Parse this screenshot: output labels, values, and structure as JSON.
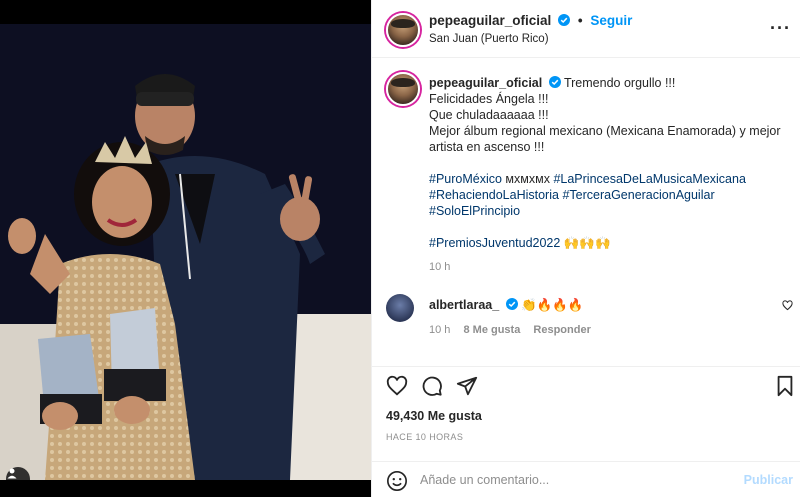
{
  "post": {
    "username": "pepeaguilar_oficial",
    "follow_label": "Seguir",
    "location": "San Juan (Puerto Rico)",
    "separator": "•"
  },
  "caption": {
    "username": "pepeaguilar_oficial",
    "lines": [
      "Tremendo orgullo !!!",
      "Felicidades Ángela !!!",
      "Que chuladaaaaaa !!!",
      "Mejor álbum regional mexicano (Mexicana Enamorada) y mejor artista en ascenso !!!"
    ],
    "hashtags_line1": [
      "#PuroMéxico",
      " мхмхмх "
    ],
    "hashtag_princesa": "#LaPrincesaDeLaMusicaMexicana",
    "hashtag_rehaciendo": "#RehaciendoLaHistoria",
    "hashtag_tercera": "#TerceraGeneracionAguilar",
    "hashtag_solo": "#SoloElPrincipio",
    "hashtag_premios": "#PremiosJuventud2022",
    "premios_emojis": "🙌🙌🙌",
    "time": "10 h"
  },
  "comment": {
    "username": "albertlaraa_",
    "emojis": "👏🔥🔥🔥",
    "time": "10 h",
    "likes": "8 Me gusta",
    "reply": "Responder"
  },
  "stats": {
    "likes": "49,430 Me gusta",
    "when": "HACE 10 HORAS"
  },
  "composer": {
    "placeholder": "Añade un comentario...",
    "publish": "Publicar"
  },
  "colors": {
    "accent": "#0095f6",
    "hashtag": "#00376b",
    "muted": "#8e8e8e",
    "publish_disabled": "#b3dbff"
  }
}
